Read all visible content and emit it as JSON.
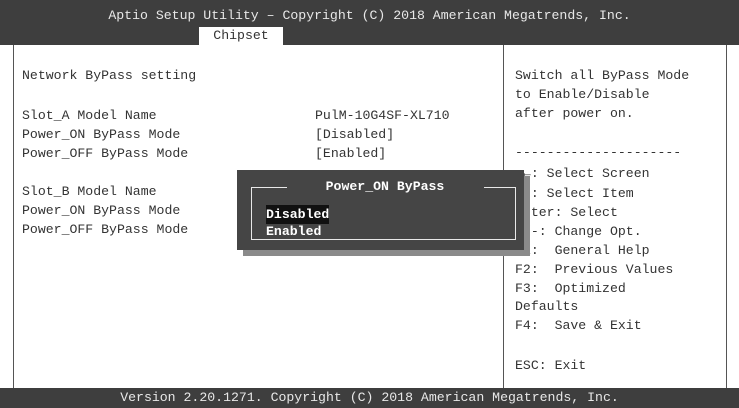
{
  "header": {
    "title": "Aptio Setup Utility – Copyright (C) 2018 American Megatrends, Inc.",
    "tab": "Chipset"
  },
  "main": {
    "section_title": "Network ByPass setting",
    "slot_a": {
      "model_label": "Slot_A Model Name",
      "model_value": "PulM-10G4SF-XL710",
      "power_on_label": "Power_ON ByPass Mode",
      "power_on_value": "[Disabled]",
      "power_off_label": "Power_OFF ByPass Mode",
      "power_off_value": "[Enabled]"
    },
    "slot_b": {
      "model_label": "Slot_B Model Name",
      "power_on_label": "Power_ON ByPass Mode",
      "power_off_label": "Power_OFF ByPass Mode"
    }
  },
  "help": {
    "description": [
      "Switch all ByPass Mode",
      "to Enable/Disable",
      "after power on."
    ],
    "separator": "---------------------",
    "keys": [
      "→←: Select Screen",
      "↑↓: Select Item",
      "Enter: Select",
      "+/-: Change Opt.",
      "F1:  General Help",
      "F2:  Previous Values",
      "F3:  Optimized",
      "Defaults",
      "F4:  Save & Exit",
      "ESC: Exit"
    ]
  },
  "popup": {
    "title": "Power_ON ByPass",
    "options": [
      "Disabled",
      "Enabled"
    ],
    "selected": "Disabled"
  },
  "footer": {
    "text": "Version 2.20.1271. Copyright (C) 2018 American Megatrends, Inc."
  },
  "colors": {
    "bar_background": "#3e3e3e",
    "popup_background": "#454545",
    "text": "#333333"
  }
}
